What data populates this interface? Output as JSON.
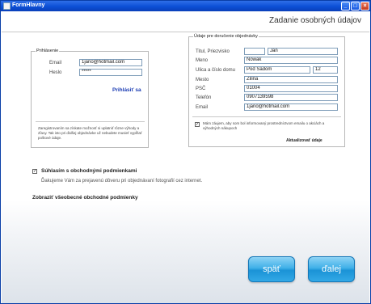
{
  "window": {
    "title": "FormHlavny"
  },
  "header": {
    "page_title": "Zadanie osobných údajov"
  },
  "login": {
    "legend": "Prihlásenie",
    "email_label": "Email",
    "email_value": "1jano@hotmail.com",
    "password_label": "Heslo",
    "password_value": "*****",
    "login_link": "Prihlásiť sa",
    "note": "Zaregistrovaním sa získate možnosť si uplatniť rôzne výhody a zľavy. Tak isto pri ďalšej objednávke už nebudete musieť vypĺňať poštové údaje."
  },
  "order": {
    "legend": "Údaje pre doručenie objednávky",
    "title_label": "Titul, Priezvisko",
    "title_value": "",
    "surname_value": "Jan",
    "name_label": "Meno",
    "name_value": "Nowak",
    "street_label": "Ulica a číslo domu",
    "street_value": "Pod Sadom",
    "house_number": "12",
    "city_label": "Mesto",
    "city_value": "Zilina",
    "zip_label": "PSČ",
    "zip_value": "01004",
    "phone_label": "Telefón",
    "phone_value": "0907139598",
    "email_label": "Email",
    "email_value": "1jano@hotmail.com",
    "newsletter_checked": true,
    "newsletter_label": "Mám záujem, aby som bol informovaný prostredníctvom emailu o akciách a výhodných nákupoch",
    "update_link": "Aktualizovať údaje"
  },
  "terms": {
    "checked": true,
    "label": "Súhlasím s obchodnými podmienkami",
    "thanks": "Ďakujeme Vám za prejavenú dôveru pri objednávaní fotografií cez internet.",
    "link": "Zobraziť všeobecné obchodné podmienky"
  },
  "nav": {
    "back_label": "späť",
    "next_label": "ďalej"
  }
}
